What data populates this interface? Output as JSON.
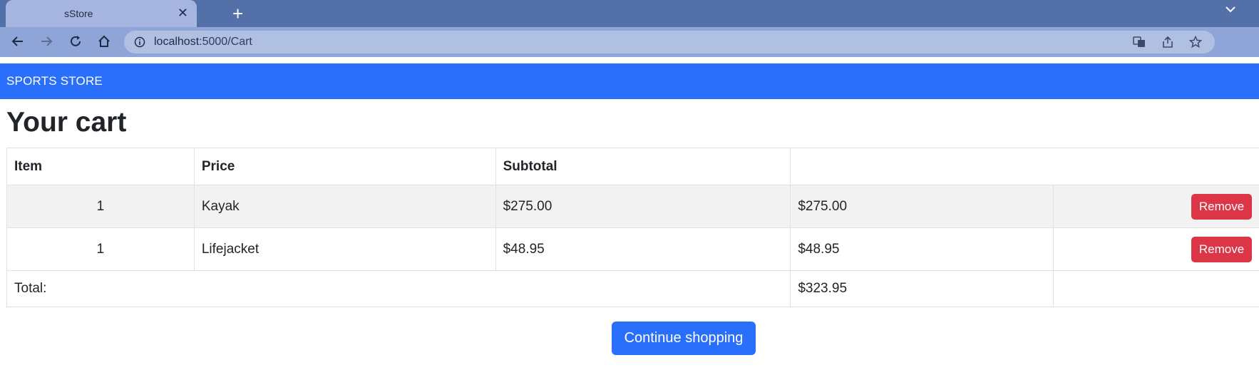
{
  "browser": {
    "tab_title": "sStore",
    "tab_close": "✕",
    "new_tab": "+",
    "url_host": "localhost",
    "url_rest": ":5000/Cart"
  },
  "app": {
    "brand": "SPORTS STORE"
  },
  "page": {
    "title": "Your cart"
  },
  "cart": {
    "headers": [
      "Item",
      "Price",
      "Subtotal",
      ""
    ],
    "rows": [
      {
        "quantity": "1",
        "name": "Kayak",
        "price": "$275.00",
        "subtotal": "$275.00",
        "action": "Remove"
      },
      {
        "quantity": "1",
        "name": "Lifejacket",
        "price": "$48.95",
        "subtotal": "$48.95",
        "action": "Remove"
      }
    ],
    "total_label": "Total:",
    "total_value": "$323.95"
  },
  "actions": {
    "continue_label": "Continue shopping"
  },
  "colors": {
    "primary": "#2a6ffc",
    "danger": "#dc3545",
    "tabstrip": "#5470a8"
  },
  "icons": [
    "back-icon",
    "forward-icon",
    "reload-icon",
    "home-icon",
    "info-icon",
    "translate-icon",
    "share-icon",
    "star-icon",
    "tab-list-icon"
  ]
}
